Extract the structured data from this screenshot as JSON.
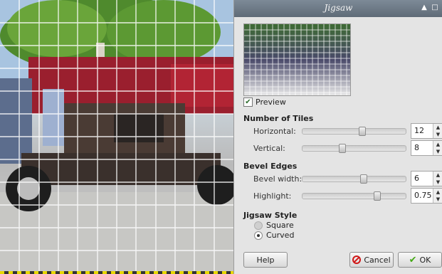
{
  "dialog": {
    "title": "Jigsaw",
    "preview_label": "Preview",
    "preview_checked": true
  },
  "tiles": {
    "section_label": "Number of Tiles",
    "horizontal_label": "Horizontal:",
    "horizontal_value": "12",
    "horizontal_level": 0.58,
    "vertical_label": "Vertical:",
    "vertical_value": "8",
    "vertical_level": 0.37
  },
  "bevel": {
    "section_label": "Bevel Edges",
    "width_label": "Bevel width:",
    "width_value": "6",
    "width_level": 0.59,
    "highlight_label": "Highlight:",
    "highlight_value": "0.75",
    "highlight_level": 0.73
  },
  "style": {
    "section_label": "Jigsaw Style",
    "options": [
      {
        "label": "Square",
        "selected": false
      },
      {
        "label": "Curved",
        "selected": true
      }
    ]
  },
  "buttons": {
    "help": "Help",
    "cancel": "Cancel",
    "ok": "OK"
  },
  "icons": {
    "cancel": "cancel-icon",
    "ok": "checkmark-icon",
    "preview_checkbox": "checkbox-icon"
  },
  "colors": {
    "titlebar": "#6b7884",
    "cancel_icon": "#d01818",
    "ok_icon": "#43a814"
  }
}
